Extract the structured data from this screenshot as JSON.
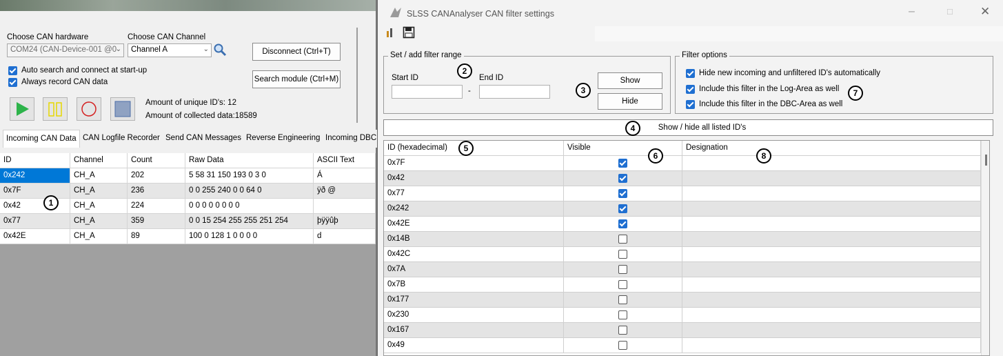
{
  "main": {
    "hardware_label": "Choose CAN hardware",
    "channel_label": "Choose CAN Channel",
    "hardware_value": "COM24 (CAN-Device-001 @0",
    "channel_value": "Channel A",
    "disconnect_label": "Disconnect (Ctrl+T)",
    "search_module_label": "Search module (Ctrl+M)",
    "auto_search_label": "Auto search and connect at start-up",
    "always_record_label": "Always record CAN data",
    "unique_ids_text": "Amount of unique ID's: 12",
    "collected_data_text": "Amount of collected data:18589",
    "tabs": [
      {
        "label": "Incoming CAN Data"
      },
      {
        "label": "CAN Logfile Recorder"
      },
      {
        "label": "Send CAN Messages"
      },
      {
        "label": "Reverse Engineering"
      },
      {
        "label": "Incoming DBC"
      }
    ],
    "table": {
      "headers": [
        "ID",
        "Channel",
        "Count",
        "Raw Data",
        "ASCII Text"
      ],
      "rows": [
        [
          "0x242",
          "CH_A",
          "202",
          "5 58 31 150 193 0 3 0",
          "Á"
        ],
        [
          "0x7F",
          "CH_A",
          "236",
          "0 0 255 240 0 0 64 0",
          "ÿð  @"
        ],
        [
          "0x42",
          "CH_A",
          "224",
          "0 0 0 0 0 0 0 0",
          ""
        ],
        [
          "0x77",
          "CH_A",
          "359",
          "0 0 15 254 255 255 251 254",
          "þÿÿûþ"
        ],
        [
          "0x42E",
          "CH_A",
          "89",
          "100 0 128 1 0 0 0 0",
          "d"
        ]
      ]
    }
  },
  "dialog": {
    "title": "SLSS CANAnalyser CAN filter settings",
    "range_group": "Set / add filter range",
    "start_id_label": "Start ID",
    "end_id_label": "End ID",
    "dash": "-",
    "show_label": "Show",
    "hide_label": "Hide",
    "options_group": "Filter options",
    "options": [
      {
        "label": "Hide new incoming and unfiltered ID's automatically",
        "checked": true
      },
      {
        "label": "Include this filter in the Log-Area as well",
        "checked": true
      },
      {
        "label": "Include this filter in the DBC-Area as well",
        "checked": true
      }
    ],
    "show_hide_all_label": "Show / hide all listed ID's",
    "table": {
      "headers": [
        "ID (hexadecimal)",
        "Visible",
        "Designation"
      ],
      "rows": [
        {
          "id": "0x7F",
          "visible": true
        },
        {
          "id": "0x42",
          "visible": true
        },
        {
          "id": "0x77",
          "visible": true
        },
        {
          "id": "0x242",
          "visible": true
        },
        {
          "id": "0x42E",
          "visible": true
        },
        {
          "id": "0x14B",
          "visible": false
        },
        {
          "id": "0x42C",
          "visible": false
        },
        {
          "id": "0x7A",
          "visible": false
        },
        {
          "id": "0x7B",
          "visible": false
        },
        {
          "id": "0x177",
          "visible": false
        },
        {
          "id": "0x230",
          "visible": false
        },
        {
          "id": "0x167",
          "visible": false
        },
        {
          "id": "0x49",
          "visible": false
        }
      ]
    }
  },
  "callouts": [
    "1",
    "2",
    "3",
    "4",
    "5",
    "6",
    "7",
    "8"
  ],
  "colors": {
    "accent": "#1f6fd1",
    "selected_row": "#0078d7",
    "play": "#2db34a",
    "pause": "#e6d800",
    "record": "#d42020",
    "stop": "#4e6ea8"
  }
}
